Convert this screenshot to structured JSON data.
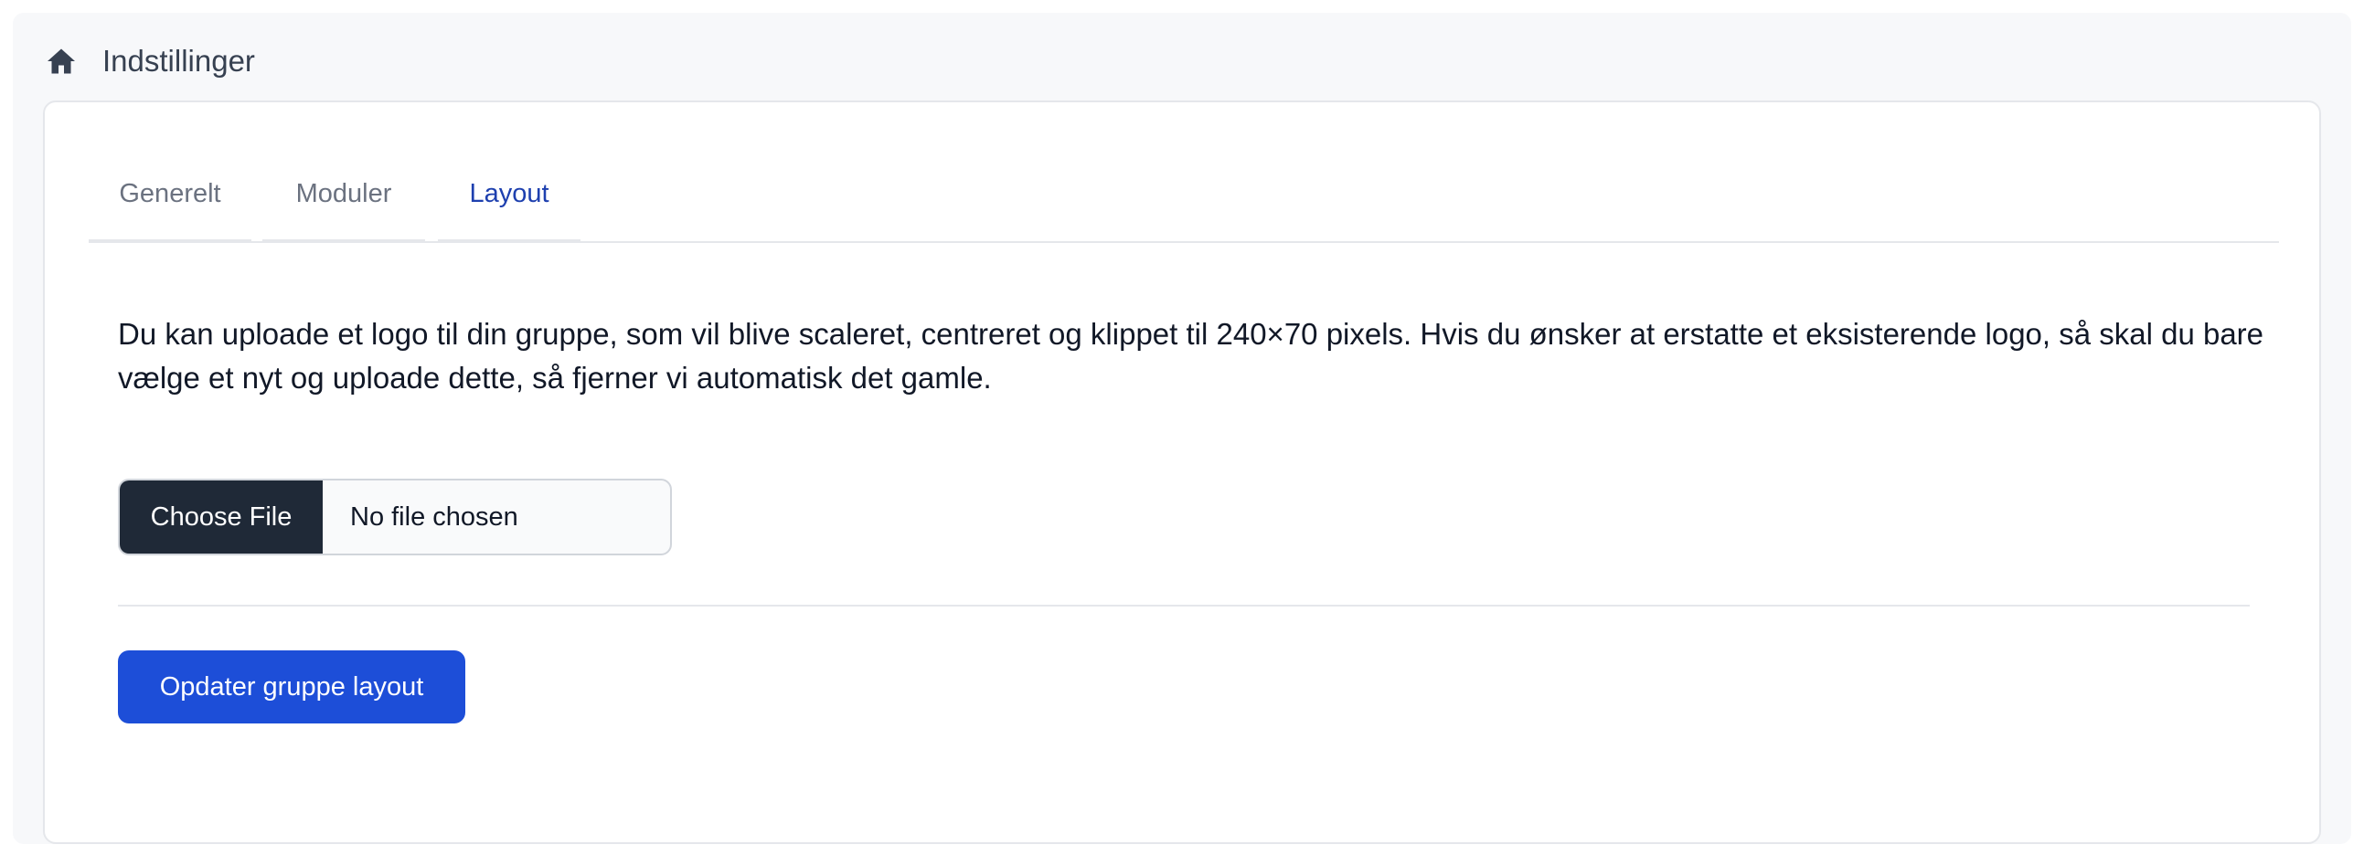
{
  "header": {
    "icon": "home-icon",
    "title": "Indstillinger"
  },
  "tabs": [
    {
      "label": "Generelt",
      "active": false
    },
    {
      "label": "Moduler",
      "active": false
    },
    {
      "label": "Layout",
      "active": true
    }
  ],
  "layout_tab": {
    "description": "Du kan uploade et logo til din gruppe, som vil blive scaleret, centreret og klippet til 240×70 pixels. Hvis du ønsker at erstatte et eksisterende logo, så skal du bare vælge et nyt og uploade dette, så fjerner vi automatisk det gamle.",
    "file_button_label": "Choose File",
    "file_status": "No file chosen",
    "submit_label": "Opdater gruppe layout"
  },
  "colors": {
    "accent": "#1d4ed8",
    "active_tab": "#1e40af",
    "file_button": "#1f2937"
  }
}
